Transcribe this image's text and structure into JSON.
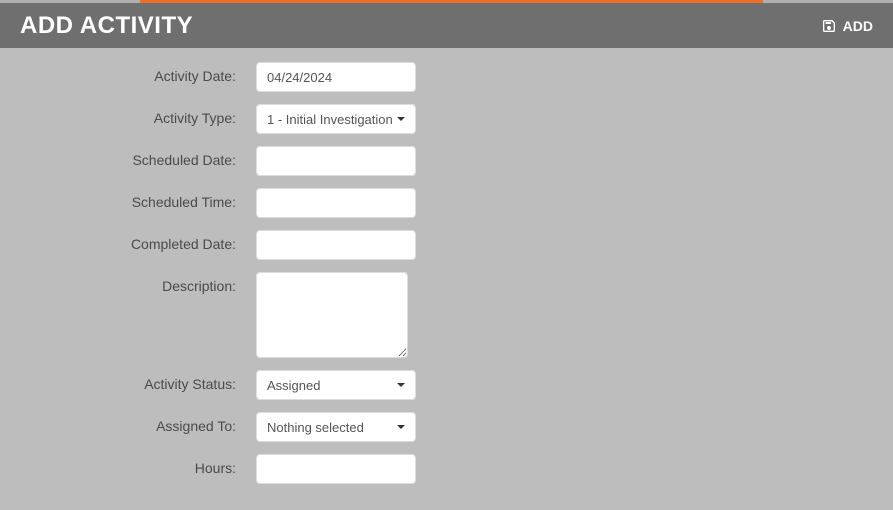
{
  "header": {
    "title": "ADD ACTIVITY",
    "add_button_label": "ADD"
  },
  "form": {
    "activity_date": {
      "label": "Activity Date:",
      "value": "04/24/2024"
    },
    "activity_type": {
      "label": "Activity Type:",
      "selected": "1 - Initial Investigation"
    },
    "scheduled_date": {
      "label": "Scheduled Date:",
      "value": ""
    },
    "scheduled_time": {
      "label": "Scheduled Time:",
      "value": ""
    },
    "completed_date": {
      "label": "Completed Date:",
      "value": ""
    },
    "description": {
      "label": "Description:",
      "value": ""
    },
    "activity_status": {
      "label": "Activity Status:",
      "selected": "Assigned"
    },
    "assigned_to": {
      "label": "Assigned To:",
      "selected": "Nothing selected"
    },
    "hours": {
      "label": "Hours:",
      "value": ""
    }
  }
}
